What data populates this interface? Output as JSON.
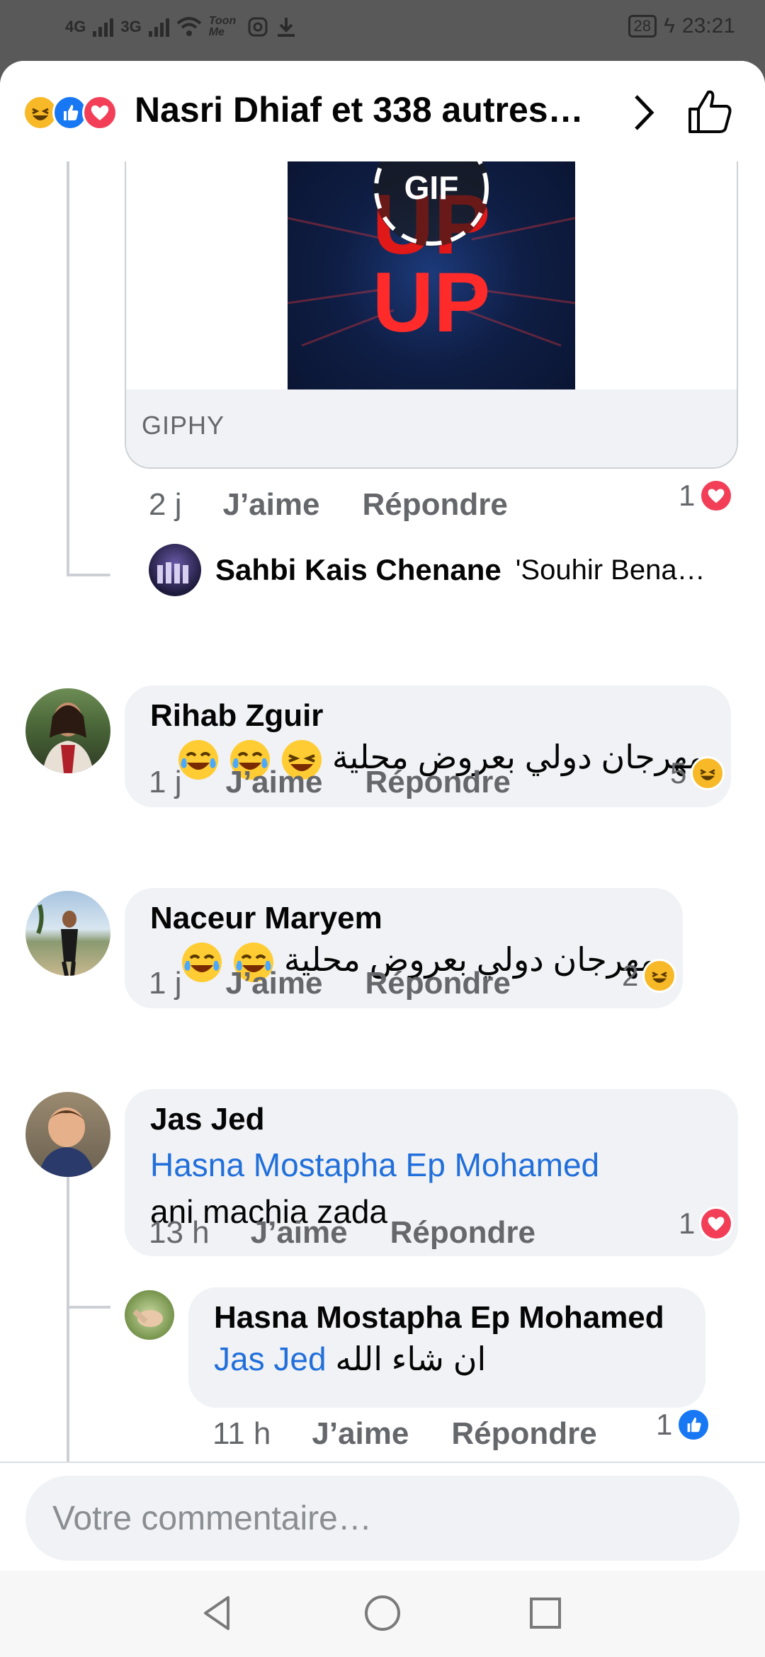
{
  "status_bar": {
    "network_1": "4G",
    "network_2": "3G",
    "carrier_badge": "Toon Me",
    "battery": "28",
    "time": "23:21"
  },
  "header": {
    "title": "Nasri Dhiaf et 338 autres…",
    "reactions": [
      "haha-icon",
      "like-icon",
      "love-icon"
    ]
  },
  "gif_card": {
    "badge": "GIF",
    "image_text": "UP UP",
    "source": "GIPHY"
  },
  "comments": [
    {
      "time": "2 j",
      "like": "J’aime",
      "reply": "Répondre",
      "reaction_count": "1",
      "reaction": "love"
    },
    {
      "author": "Rihab Zguir",
      "text": "مهرجان دولي بعروض محلية",
      "time": "1 j",
      "like": "J’aime",
      "reply": "Répondre",
      "reaction_count": "5",
      "reaction": "haha"
    },
    {
      "author": "Naceur Maryem",
      "text": "مهرجان دولي بعروض محلية",
      "time": "1 j",
      "like": "J’aime",
      "reply": "Répondre",
      "reaction_count": "2",
      "reaction": "haha"
    },
    {
      "author": "Jas Jed",
      "mention": "Hasna Mostapha Ep Mohamed",
      "text": "ani machia zada",
      "time": "13 h",
      "like": "J’aime",
      "reply": "Répondre",
      "reaction_count": "1",
      "reaction": "love"
    },
    {
      "author": "Hasna Mostapha Ep Mohamed",
      "mention": "Jas Jed",
      "text": "ان شاء الله",
      "time": "11 h",
      "like": "J’aime",
      "reply": "Répondre",
      "reaction_count": "1",
      "reaction": "like"
    }
  ],
  "collapsed_reply": {
    "author": "Sahbi Kais Chenane",
    "preview": "'Souhir Bena…"
  },
  "composer": {
    "placeholder": "Votre commentaire…"
  },
  "colors": {
    "link": "#216fdb",
    "love": "#f33e58",
    "like": "#1877f2",
    "haha": "#f7b928",
    "bubble": "#f0f2f5",
    "meta": "#65676b"
  }
}
